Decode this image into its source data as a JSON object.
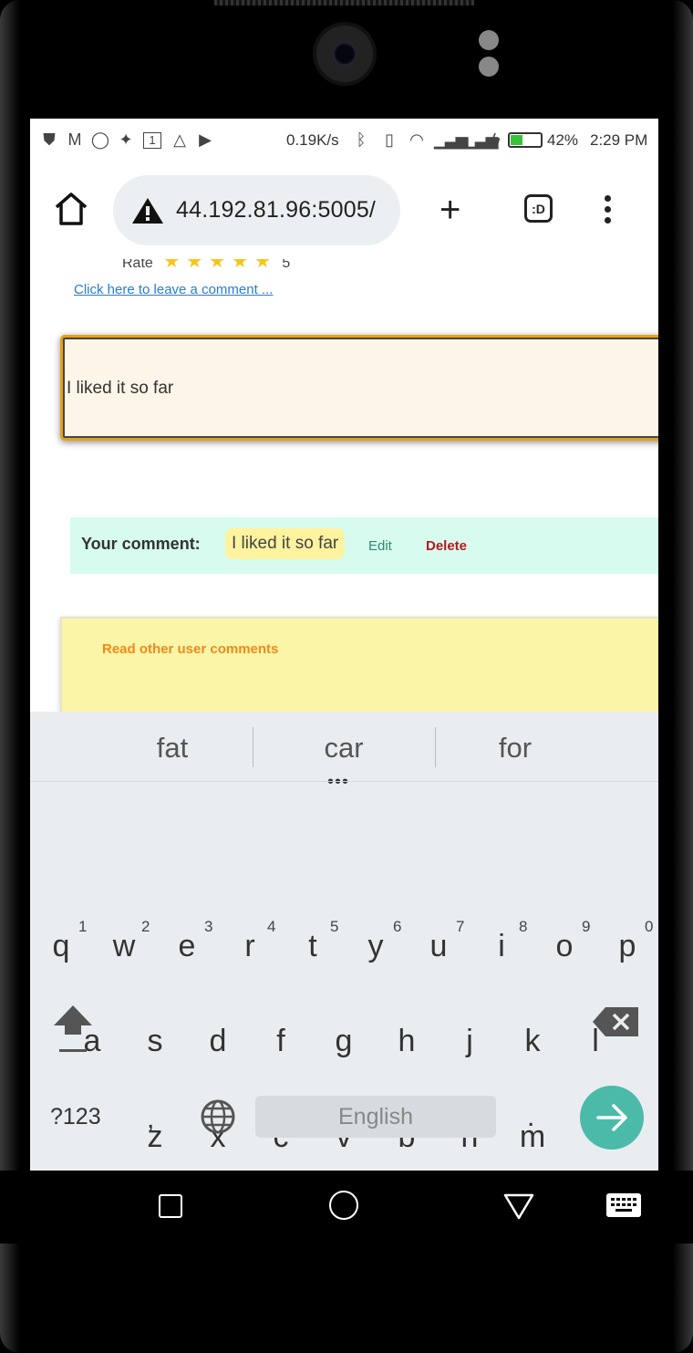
{
  "status": {
    "net_speed": "0.19K/s",
    "battery_pct": "42%",
    "battery_level": 0.42,
    "time": "2:29 PM",
    "left_icons": [
      "shield-icon",
      "gmail-icon",
      "chat-icon",
      "puzzle-icon",
      "calendar-icon",
      "drive-icon",
      "youtube-icon"
    ],
    "right_icons": [
      "bluetooth-icon",
      "vibrate-icon",
      "wifi-icon",
      "signal-icon",
      "signal-icon",
      "charging-icon"
    ],
    "calendar_num": "1"
  },
  "browser": {
    "url": "44.192.81.96:5005/",
    "tabs_label": ":D"
  },
  "page": {
    "rate_label": "Rate",
    "rate_value": "5",
    "stars": 5,
    "comment_link": "Click here to leave a comment ...",
    "comment_input_value": "I liked it so far",
    "your_comment_label": "Your comment:",
    "your_comment_text": "I liked it so far",
    "edit_label": "Edit",
    "delete_label": "Delete",
    "others_title": "Read other user comments",
    "accent_orange": "#e7a113",
    "delete_red": "#b3191f"
  },
  "keyboard": {
    "suggestions": [
      "fat",
      "car",
      "for"
    ],
    "row1": [
      "q",
      "w",
      "e",
      "r",
      "t",
      "y",
      "u",
      "i",
      "o",
      "p"
    ],
    "row1_hints": [
      "1",
      "2",
      "3",
      "4",
      "5",
      "6",
      "7",
      "8",
      "9",
      "0"
    ],
    "row2": [
      "a",
      "s",
      "d",
      "f",
      "g",
      "h",
      "j",
      "k",
      "l"
    ],
    "row3": [
      "z",
      "x",
      "c",
      "v",
      "b",
      "n",
      "m"
    ],
    "symbols_label": "?123",
    "comma": ",",
    "space_label": "English",
    "period": ".",
    "enter_color": "#4cbaa9"
  },
  "navbar": {
    "icons": [
      "recents-icon",
      "home-icon",
      "back-icon",
      "keyboard-icon"
    ]
  }
}
